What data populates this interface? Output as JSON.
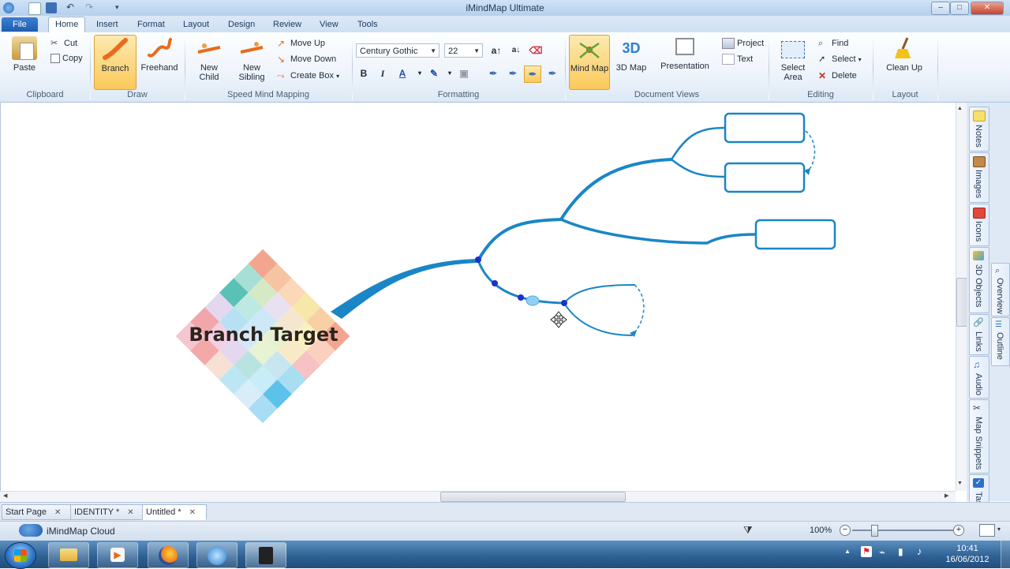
{
  "window": {
    "title": "iMindMap Ultimate",
    "minimize": "–",
    "maximize": "□",
    "close": "✕"
  },
  "tabs": [
    {
      "label": "File"
    },
    {
      "label": "Home"
    },
    {
      "label": "Insert"
    },
    {
      "label": "Format"
    },
    {
      "label": "Layout"
    },
    {
      "label": "Design"
    },
    {
      "label": "Review"
    },
    {
      "label": "View"
    },
    {
      "label": "Tools"
    }
  ],
  "ribbon": {
    "clipboard": {
      "label": "Clipboard",
      "paste": "Paste",
      "cut": "Cut",
      "copy": "Copy"
    },
    "draw": {
      "label": "Draw",
      "branch": "Branch",
      "freehand": "Freehand"
    },
    "speed": {
      "label": "Speed Mind Mapping",
      "new_child_1": "New",
      "new_child_2": "Child",
      "new_sibling_1": "New",
      "new_sibling_2": "Sibling",
      "move_up": "Move Up",
      "move_down": "Move Down",
      "create_box": "Create Box"
    },
    "formatting": {
      "label": "Formatting",
      "font": "Century Gothic",
      "size": "22",
      "bold": "B",
      "italic": "I",
      "font_color": "A"
    },
    "views": {
      "label": "Document Views",
      "mind_map": "Mind Map",
      "map_3d": "3D Map",
      "presentation": "Presentation",
      "project": "Project",
      "text": "Text"
    },
    "editing": {
      "label": "Editing",
      "select_area_1": "Select",
      "select_area_2": "Area",
      "find": "Find",
      "select": "Select",
      "delete": "Delete"
    },
    "layout": {
      "label": "Layout",
      "clean_up": "Clean Up"
    }
  },
  "canvas": {
    "central_topic": "Branch Target",
    "branch_color": "#1a86c6"
  },
  "sidebar": {
    "tabs": [
      "Notes",
      "Images",
      "Icons",
      "3D Objects",
      "Links",
      "Audio",
      "Map Snippets",
      "Tasks"
    ],
    "right_tabs": [
      "Overview",
      "Outline"
    ]
  },
  "doc_tabs": [
    {
      "label": "Start Page",
      "active": false
    },
    {
      "label": "IDENTITY *",
      "active": false
    },
    {
      "label": "Untitled *",
      "active": true
    }
  ],
  "status": {
    "cloud": "iMindMap Cloud",
    "zoom": "100%"
  },
  "taskbar": {
    "time": "10:41",
    "date": "16/06/2012"
  }
}
